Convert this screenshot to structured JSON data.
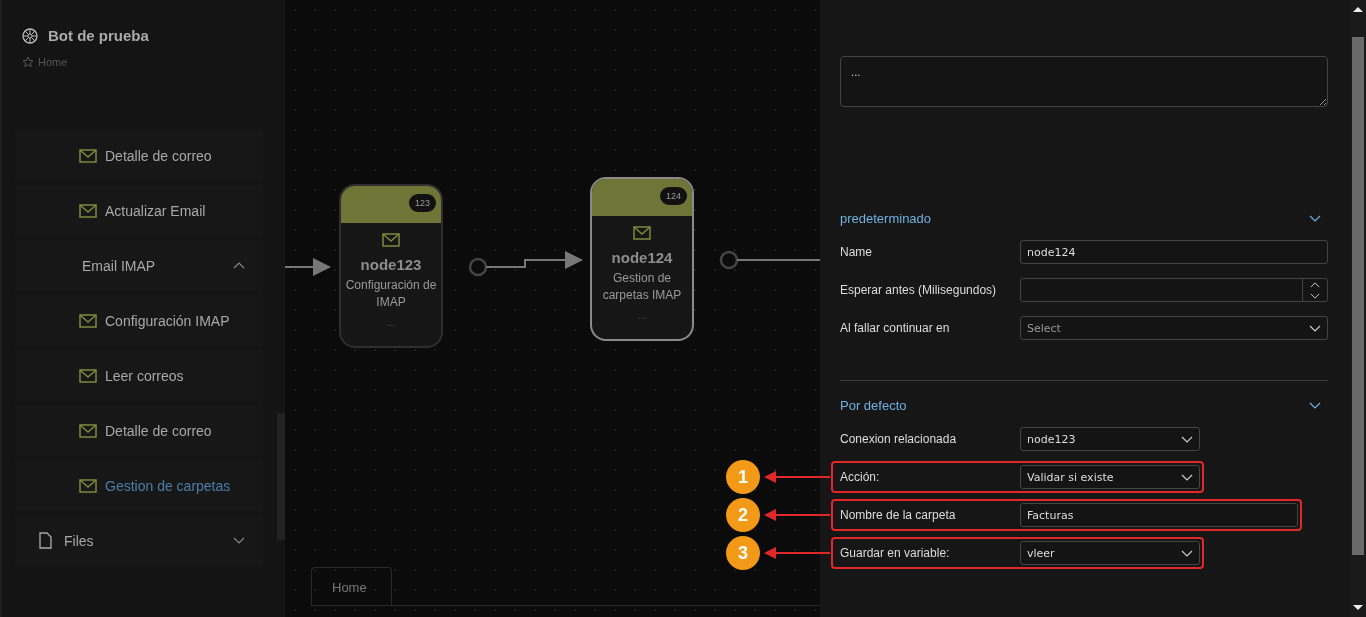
{
  "sidebar": {
    "title": "Bot de prueba",
    "breadcrumb": "Home",
    "items": [
      {
        "kind": "leaf",
        "label": "Detalle de correo",
        "selected": false
      },
      {
        "kind": "leaf",
        "label": "Actualizar Email",
        "selected": false
      },
      {
        "kind": "group",
        "label": "Email IMAP",
        "expanded": true
      },
      {
        "kind": "leaf",
        "label": "Configuración IMAP",
        "selected": false
      },
      {
        "kind": "leaf",
        "label": "Leer correos",
        "selected": false
      },
      {
        "kind": "leaf",
        "label": "Detalle de correo",
        "selected": false
      },
      {
        "kind": "leaf",
        "label": "Gestion de carpetas",
        "selected": true
      },
      {
        "kind": "file-group",
        "label": "Files",
        "expanded": false
      }
    ]
  },
  "canvas": {
    "nodes": [
      {
        "badge": "123",
        "name": "node123",
        "description": "Configuración de IMAP",
        "more": "...",
        "selected": false
      },
      {
        "badge": "124",
        "name": "node124",
        "description": "Gestion de carpetas IMAP",
        "more": "...",
        "selected": true
      }
    ],
    "tab": "Home"
  },
  "panel": {
    "notes": "...",
    "sections": [
      {
        "title": "predeterminado",
        "expanded": true,
        "fields": [
          {
            "label": "Name",
            "kind": "text",
            "value": "node124"
          },
          {
            "label": "Esperar antes (Milisegundos)",
            "kind": "number"
          },
          {
            "label": "Al fallar continuar en",
            "kind": "select",
            "placeholder": "Select"
          }
        ]
      },
      {
        "title": "Por defecto",
        "expanded": true,
        "fields": [
          {
            "label": "Conexion relacionada",
            "kind": "select",
            "value": "node123"
          },
          {
            "label": "Acción:",
            "kind": "select",
            "value": "Validar si existe",
            "highlighted": true,
            "callout": "1"
          },
          {
            "label": "Nombre de la carpeta",
            "kind": "text",
            "value": "Facturas",
            "highlighted": true,
            "callout": "2"
          },
          {
            "label": "Guardar en variable:",
            "kind": "select",
            "value": "vleer",
            "highlighted": true,
            "callout": "3"
          }
        ]
      }
    ]
  }
}
